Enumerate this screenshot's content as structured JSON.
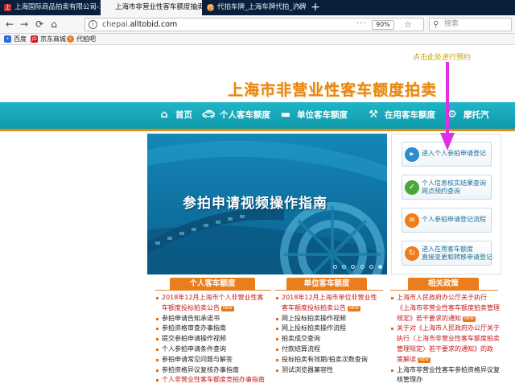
{
  "browser": {
    "tabs": [
      {
        "title": "上海国际商品拍卖有限公司-联",
        "active": false
      },
      {
        "title": "上海市非营业性客车额度拍卖",
        "active": true
      },
      {
        "title": "代拍车牌_上海车牌代拍_沪牌|",
        "active": false
      }
    ],
    "url_prefix": "chepai.",
    "url_domain": "alltobid.com",
    "zoom": "90%",
    "search_placeholder": "搜索",
    "bookmarks": [
      "百度",
      "京东商城",
      "代拍吧"
    ]
  },
  "page": {
    "hint": "点击此处进行预约",
    "site_title": "上海市非营业性客车额度拍卖",
    "nav": [
      "首页",
      "个人客车额度",
      "单位客车额度",
      "在用客车额度",
      "摩托汽"
    ],
    "banner_text": "参拍申请视频操作指南",
    "banner_dot_count": 6,
    "side_links": [
      {
        "lines": [
          "进入个人参拍申请登记"
        ],
        "color": "#2e8ccf",
        "icon": "person-icon"
      },
      {
        "lines": [
          "个人信息核实结果查询",
          "网点预约查询"
        ],
        "color": "#4aa83b",
        "icon": "check-icon"
      },
      {
        "lines": [
          "个人参拍申请登记流程"
        ],
        "color": "#ee7d18",
        "icon": "flow-icon"
      },
      {
        "lines": [
          "进入在用客车额度",
          "直接变更和转移申请登记"
        ],
        "color": "#ee7d18",
        "icon": "refresh-icon"
      }
    ],
    "columns": [
      {
        "title": "个人客车额度",
        "items": [
          {
            "text": "2018年12月上海市个人非营业性客",
            "red": true,
            "bullet": true
          },
          {
            "text": "车额度投标拍卖公告",
            "red": true,
            "bullet": false,
            "new": true
          },
          {
            "text": "参拍申请告知承诺书",
            "red": false,
            "bullet": true
          },
          {
            "text": "参拍资格审查办事指南",
            "red": false,
            "bullet": true
          },
          {
            "text": "提交参拍申请操作视频",
            "red": false,
            "bullet": true
          },
          {
            "text": "个人参拍申请条件查询",
            "red": false,
            "bullet": true
          },
          {
            "text": "参拍申请常见问题与解答",
            "red": false,
            "bullet": true
          },
          {
            "text": "参拍资格异议复核办事指南",
            "red": false,
            "bullet": true
          },
          {
            "text": "个人非营业性客车额度竞拍办事指南",
            "red": true,
            "bullet": true
          }
        ]
      },
      {
        "title": "单位客车额度",
        "items": [
          {
            "text": "2018年12月上海市单位非营业性",
            "red": true,
            "bullet": true
          },
          {
            "text": "客车额度投标拍卖公告",
            "red": true,
            "bullet": false,
            "new": true
          },
          {
            "text": "网上投标拍卖操作视频",
            "red": false,
            "bullet": true
          },
          {
            "text": "网上投标拍卖操作流程",
            "red": false,
            "bullet": true
          },
          {
            "text": "拍卖成交查询",
            "red": false,
            "bullet": true
          },
          {
            "text": "付款结算流程",
            "red": false,
            "bullet": true
          },
          {
            "text": "投标拍卖有效期/拍卖次数查询",
            "red": false,
            "bullet": true
          },
          {
            "text": "测试浏览器兼容性",
            "red": false,
            "bullet": true
          }
        ]
      },
      {
        "title": "相关政策",
        "items": [
          {
            "text": "上海市人民政府办公厅关于执行",
            "red": true,
            "bullet": true
          },
          {
            "text": "《上海市非营业性客车额度拍卖管理",
            "red": true,
            "bullet": false
          },
          {
            "text": "规定》若干要求的通知",
            "red": true,
            "bullet": false,
            "new": true
          },
          {
            "text": "关于对《上海市人民政府办公厅关于",
            "red": true,
            "bullet": true
          },
          {
            "text": "执行〈上海市非营业性客车额度拍卖",
            "red": true,
            "bullet": false
          },
          {
            "text": "管理规定〉若干要求的通知》的政",
            "red": true,
            "bullet": false
          },
          {
            "text": "策解读",
            "red": true,
            "bullet": false,
            "new": true
          },
          {
            "text": "上海市非营业性客车参拍资格异议复",
            "red": false,
            "bullet": true
          },
          {
            "text": "核管理办",
            "red": false,
            "bullet": false
          }
        ]
      }
    ]
  }
}
